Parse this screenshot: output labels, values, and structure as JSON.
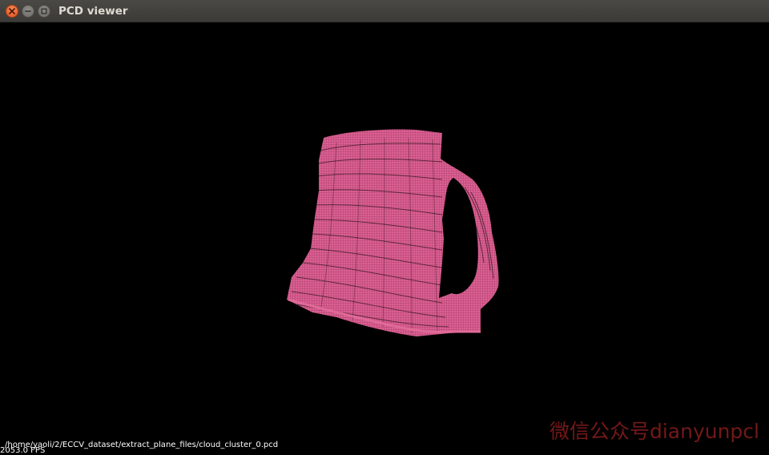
{
  "window": {
    "title": "PCD viewer",
    "buttons": {
      "close": "close-icon",
      "minimize": "minimize-icon",
      "maximize": "maximize-icon"
    }
  },
  "viewer": {
    "background": "#000000",
    "point_color": "#d65a8c",
    "object": "mug-point-cloud",
    "file_path": "/home/yaoli/2/ECCV_dataset/extract_plane_files/cloud_cluster_0.pcd",
    "fps": "2053.0 FPS"
  },
  "watermark": {
    "text": "微信公众号dianyunpcl",
    "color": "#7a1a1a"
  },
  "colors": {
    "titlebar": "#3c3b37",
    "close_button": "#e95420"
  }
}
